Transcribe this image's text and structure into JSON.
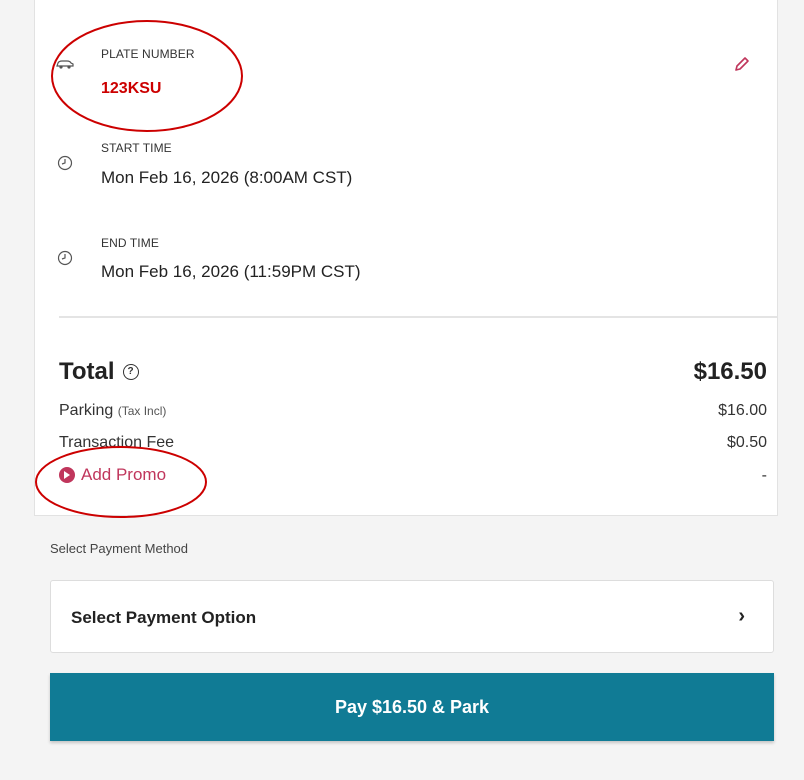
{
  "vehicle": {
    "plate_label": "PLATE NUMBER",
    "plate_value": "123KSU",
    "icon": "car-icon",
    "edit_icon": "pencil-icon"
  },
  "start": {
    "label": "START TIME",
    "value": "Mon Feb 16, 2026 (8:00AM CST)",
    "icon": "clock-icon"
  },
  "end": {
    "label": "END TIME",
    "value": "Mon Feb 16, 2026 (11:59PM CST)",
    "icon": "clock-icon"
  },
  "summary": {
    "total_label": "Total",
    "help_icon": "help-circle-icon",
    "total_amount": "$16.50",
    "parking_label": "Parking",
    "parking_note": "(Tax Incl)",
    "parking_amount": "$16.00",
    "fee_label": "Transaction Fee",
    "fee_amount": "$0.50",
    "promo_label": "Add Promo",
    "promo_amount": "-"
  },
  "payment": {
    "section_title": "Select Payment Method",
    "option_label": "Select Payment Option",
    "chevron": "›",
    "pay_button": "Pay $16.50 & Park"
  },
  "colors": {
    "accent": "#107b95",
    "promo": "#c0365c",
    "annotation": "#cc0000"
  }
}
